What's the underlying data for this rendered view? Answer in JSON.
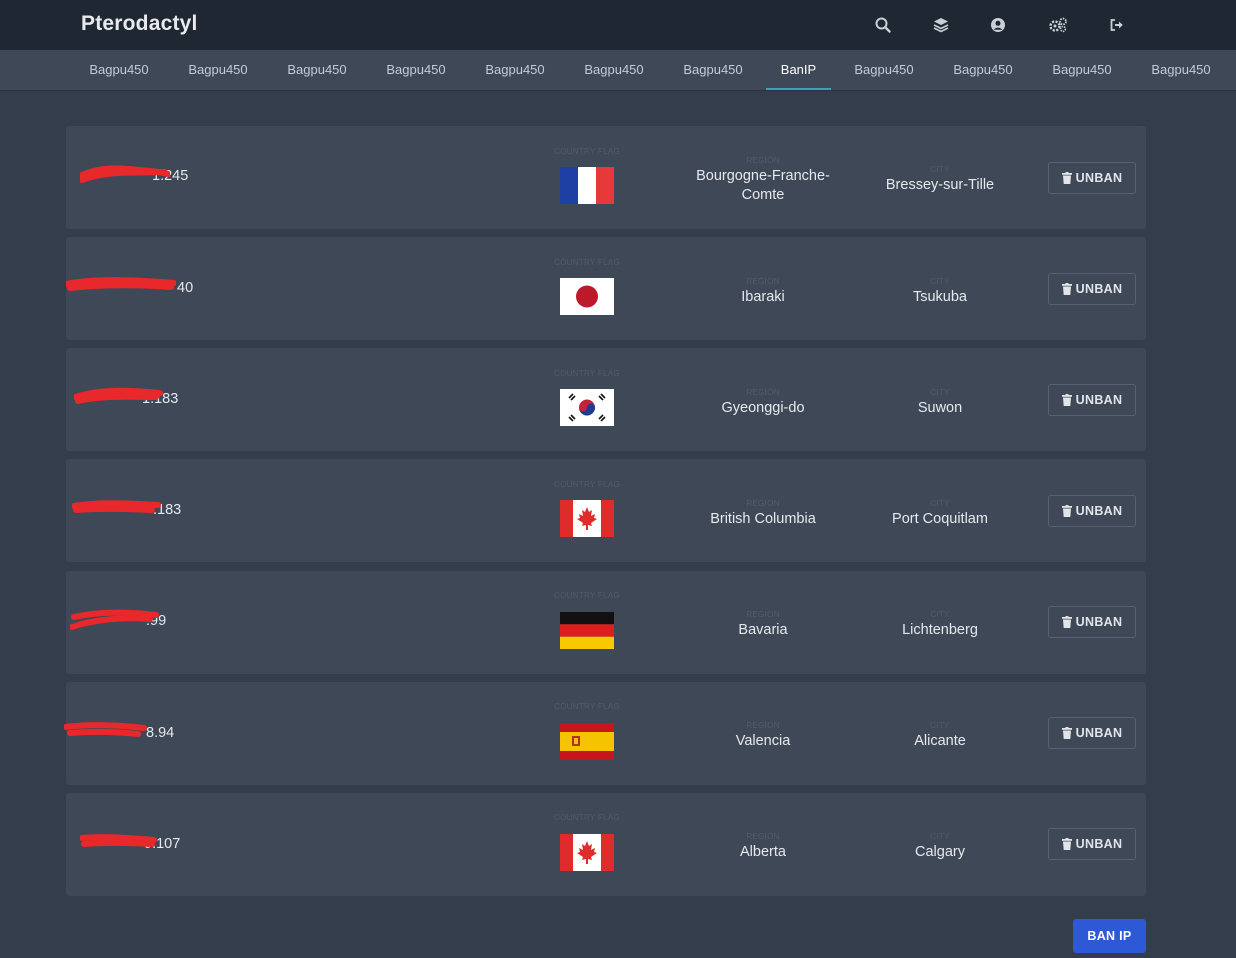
{
  "app": {
    "title": "Pterodactyl"
  },
  "header_icons": [
    "search-icon",
    "layers-icon",
    "user-circle-icon",
    "cogs-icon",
    "logout-icon"
  ],
  "tabs": [
    {
      "label": "Bagpu450",
      "active": false
    },
    {
      "label": "Bagpu450",
      "active": false
    },
    {
      "label": "Bagpu450",
      "active": false
    },
    {
      "label": "Bagpu450",
      "active": false
    },
    {
      "label": "Bagpu450",
      "active": false
    },
    {
      "label": "Bagpu450",
      "active": false
    },
    {
      "label": "Bagpu450",
      "active": false
    },
    {
      "label": "BanIP",
      "active": true
    },
    {
      "label": "Bagpu450",
      "active": false
    },
    {
      "label": "Bagpu450",
      "active": false
    },
    {
      "label": "Bagpu450",
      "active": false
    },
    {
      "label": "Bagpu450",
      "active": false
    }
  ],
  "labels": {
    "flag": "COUNTRY FLAG",
    "region": "REGION",
    "city": "CITY"
  },
  "bans": [
    {
      "ip": "1.245",
      "flag": "france-flag",
      "region": "Bourgogne-Franche-Comte",
      "city": "Bressey-sur-Tille",
      "unban": "UNBAN"
    },
    {
      "ip": "40",
      "flag": "japan-flag",
      "region": "Ibaraki",
      "city": "Tsukuba",
      "unban": "UNBAN"
    },
    {
      "ip": "1.183",
      "flag": "south-korea-flag",
      "region": "Gyeonggi-do",
      "city": "Suwon",
      "unban": "UNBAN"
    },
    {
      "ip": ".183",
      "flag": "canada-flag",
      "region": "British Columbia",
      "city": "Port Coquitlam",
      "unban": "UNBAN"
    },
    {
      "ip": ".99",
      "flag": "germany-flag",
      "region": "Bavaria",
      "city": "Lichtenberg",
      "unban": "UNBAN"
    },
    {
      "ip": "8.94",
      "flag": "spain-flag",
      "region": "Valencia",
      "city": "Alicante",
      "unban": "UNBAN"
    },
    {
      "ip": "9.107",
      "flag": "canada-flag",
      "region": "Alberta",
      "city": "Calgary",
      "unban": "UNBAN"
    }
  ],
  "actions": {
    "ban_ip": "BAN IP"
  },
  "colors": {
    "accent_tab": "#38a4b4",
    "primary_button": "#2d58d6",
    "redaction": "#e8282b"
  }
}
